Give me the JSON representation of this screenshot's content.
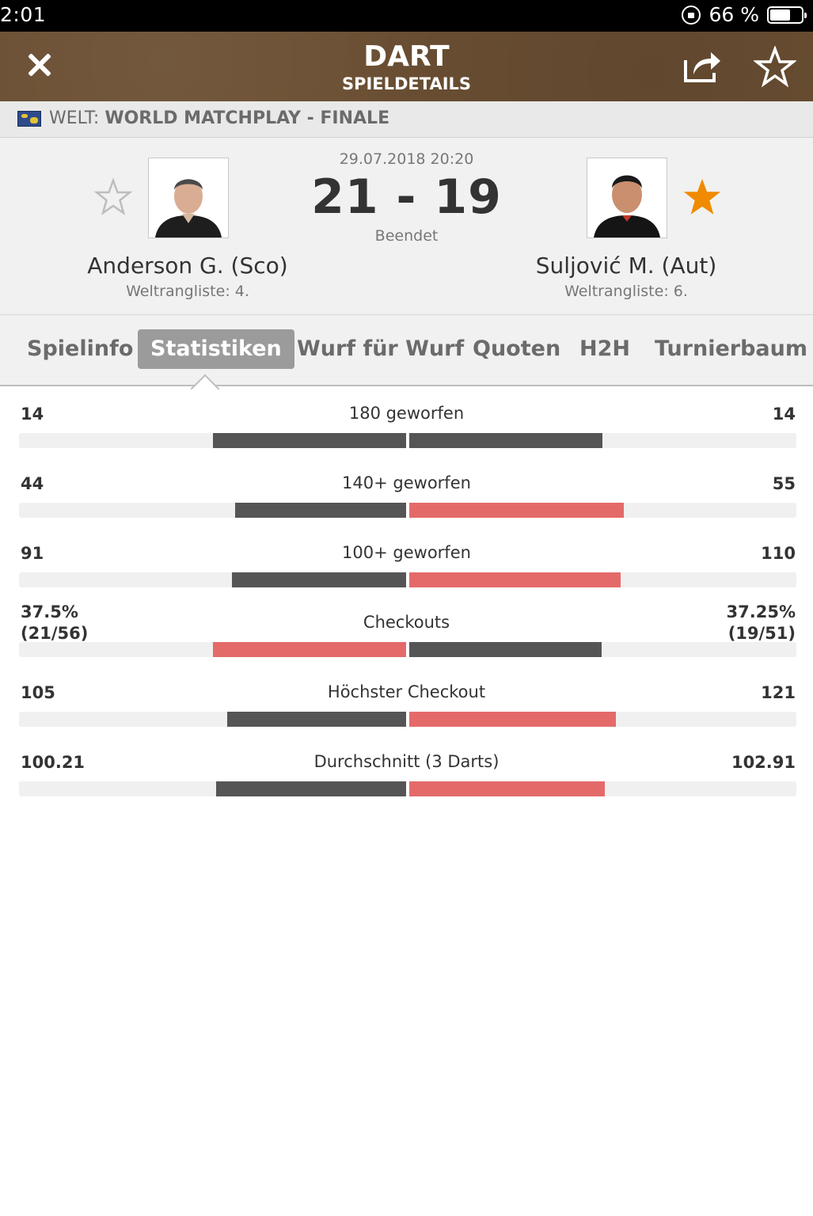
{
  "status_bar": {
    "time": "2:01",
    "battery": "66 %",
    "battery_level": 0.66
  },
  "header": {
    "title": "DART",
    "subtitle": "SPIELDETAILS"
  },
  "competition": {
    "region": "WELT:",
    "name": "WORLD MATCHPLAY - FINALE"
  },
  "match": {
    "datetime": "29.07.2018 20:20",
    "score": "21 - 19",
    "status": "Beendet",
    "home": {
      "name": "Anderson G. (Sco)",
      "rank": "Weltrangliste: 4.",
      "favorite": false
    },
    "away": {
      "name": "Suljović M. (Aut)",
      "rank": "Weltrangliste: 6.",
      "favorite": true
    }
  },
  "tabs": [
    {
      "label": "Spielinfo",
      "active": false
    },
    {
      "label": "Statistiken",
      "active": true
    },
    {
      "label": "Wurf für Wurf",
      "active": false
    },
    {
      "label": "Quoten",
      "active": false
    },
    {
      "label": "H2H",
      "active": false
    },
    {
      "label": "Turnierbaum",
      "active": false
    }
  ],
  "stats": [
    {
      "label": "180 geworfen",
      "home": "14",
      "home_sub": "",
      "away": "14",
      "away_sub": "",
      "home_pct": 50,
      "away_pct": 50,
      "highlight": "none"
    },
    {
      "label": "140+ geworfen",
      "home": "44",
      "home_sub": "",
      "away": "55",
      "away_sub": "",
      "home_pct": 44.4,
      "away_pct": 55.6,
      "highlight": "away"
    },
    {
      "label": "100+ geworfen",
      "home": "91",
      "home_sub": "",
      "away": "110",
      "away_sub": "",
      "home_pct": 45.3,
      "away_pct": 54.7,
      "highlight": "away"
    },
    {
      "label": "Checkouts",
      "home": "37.5%",
      "home_sub": "(21/56)",
      "away": "37.25%",
      "away_sub": "(19/51)",
      "home_pct": 50.2,
      "away_pct": 49.8,
      "highlight": "home"
    },
    {
      "label": "Höchster Checkout",
      "home": "105",
      "home_sub": "",
      "away": "121",
      "away_sub": "",
      "home_pct": 46.5,
      "away_pct": 53.5,
      "highlight": "away"
    },
    {
      "label": "Durchschnitt (3 Darts)",
      "home": "100.21",
      "home_sub": "",
      "away": "102.91",
      "away_sub": "",
      "home_pct": 49.3,
      "away_pct": 50.7,
      "highlight": "away"
    }
  ],
  "colors": {
    "header_bg": "#6b4f33",
    "bar_dark": "#555555",
    "bar_highlight": "#e46a6a",
    "track": "#f0f0f0",
    "fav_star": "#f08a00"
  }
}
